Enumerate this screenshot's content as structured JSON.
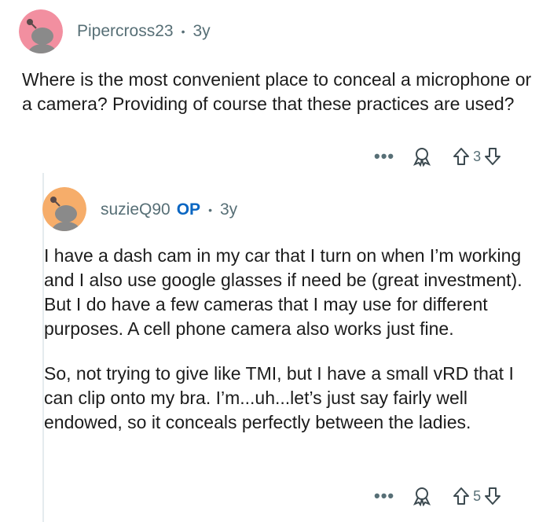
{
  "comments": [
    {
      "username": "Pipercross23",
      "separator": "•",
      "age": "3y",
      "body": [
        "Where is the most convenient place to conceal a microphone or a camera? Providing of course that these practices are used?"
      ],
      "more": "•••",
      "votes": "3",
      "avatar_color": "#f28fa0"
    },
    {
      "username": "suzieQ90",
      "op_badge": "OP",
      "separator": "•",
      "age": "3y",
      "body": [
        "I have a dash cam in my car that I turn on when I’m working and I also use google glasses if need be (great investment). But I do have a few cameras that I may use for different purposes. A cell phone camera also works just fine.",
        "So, not trying to give like TMI, but I have a small vRD that I can clip onto my bra. I’m...uh...let’s just say fairly well endowed, so it conceals perfectly between the ladies."
      ],
      "more": "•••",
      "votes": "5",
      "avatar_color": "#f6ad6a"
    }
  ]
}
